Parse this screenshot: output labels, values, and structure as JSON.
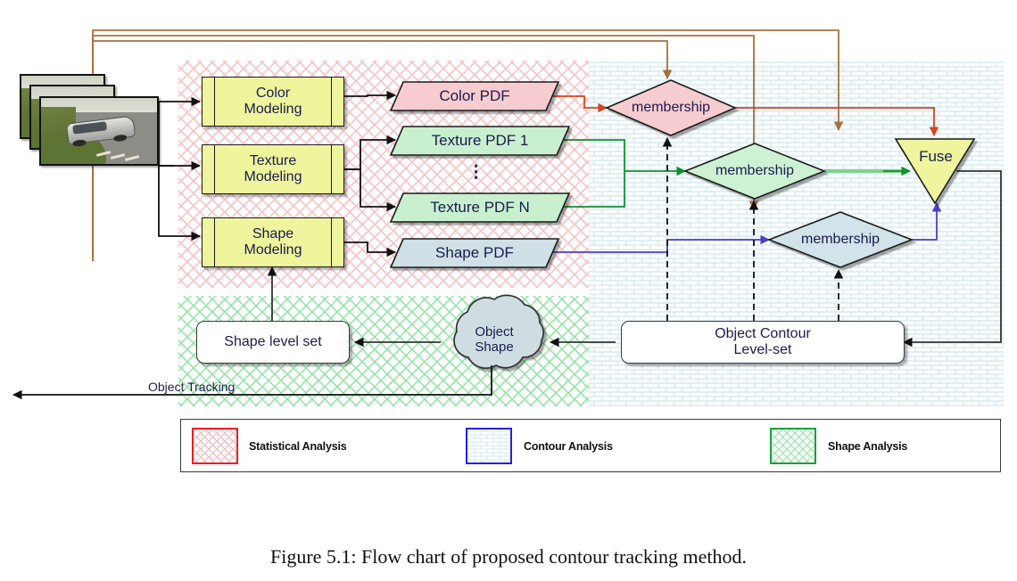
{
  "figure": {
    "caption": "Figure 5.1:  Flow chart of proposed contour tracking method."
  },
  "diagram": {
    "title": "Flow chart of proposed contour tracking method",
    "input": {
      "name": "input-image-sequence",
      "frames": 3
    },
    "modeling_blocks": [
      {
        "id": "color-modeling",
        "label": "Color\nModeling"
      },
      {
        "id": "texture-modeling",
        "label": "Texture\nModeling"
      },
      {
        "id": "shape-modeling",
        "label": "Shape\nModeling"
      }
    ],
    "pdf_nodes": [
      {
        "id": "color-pdf",
        "label": "Color PDF",
        "fill": "#f7ccd0"
      },
      {
        "id": "texture-pdf-1",
        "label": "Texture PDF 1",
        "fill": "#c8f0ce"
      },
      {
        "id": "texture-pdf-n",
        "label": "Texture PDF N",
        "fill": "#c8f0ce"
      },
      {
        "id": "shape-pdf",
        "label": "Shape PDF",
        "fill": "#cfe0e6"
      }
    ],
    "ellipsis": "⋮",
    "membership_nodes": [
      {
        "id": "membership-color",
        "label": "membership",
        "fill": "#f7ccd0"
      },
      {
        "id": "membership-texture",
        "label": "membership",
        "fill": "#ccf2d3"
      },
      {
        "id": "membership-shape",
        "label": "membership",
        "fill": "#d2e3e9"
      }
    ],
    "fuse": {
      "id": "fuse",
      "label": "Fuse",
      "fill": "#eef59c"
    },
    "object_contour": {
      "id": "object-contour-level-set",
      "label": "Object Contour\nLevel-set"
    },
    "object_shape": {
      "id": "object-shape",
      "label": "Object\nShape",
      "fill": "#cfdde3"
    },
    "shape_level_set": {
      "id": "shape-level-set",
      "label": "Shape level set"
    },
    "tracking_label": "Object Tracking"
  },
  "legend": {
    "items": [
      {
        "label": "Statistical Analysis",
        "color": "#ee1c25",
        "pattern": "diagonal-cross"
      },
      {
        "label": "Contour Analysis",
        "color": "#2222dd",
        "pattern": "brick"
      },
      {
        "label": "Shape Analysis",
        "color": "#17a13a",
        "pattern": "diagonal-cross"
      }
    ]
  },
  "colors": {
    "statistical_region": "#f9d4d6",
    "contour_region": "#cfe8ef",
    "shape_region": "#a9e8b5",
    "feedback_line": "#a6703c",
    "color_flow": "#d8441b",
    "texture_flow": "#0f8f2f",
    "shape_flow": "#4a3fc4"
  }
}
